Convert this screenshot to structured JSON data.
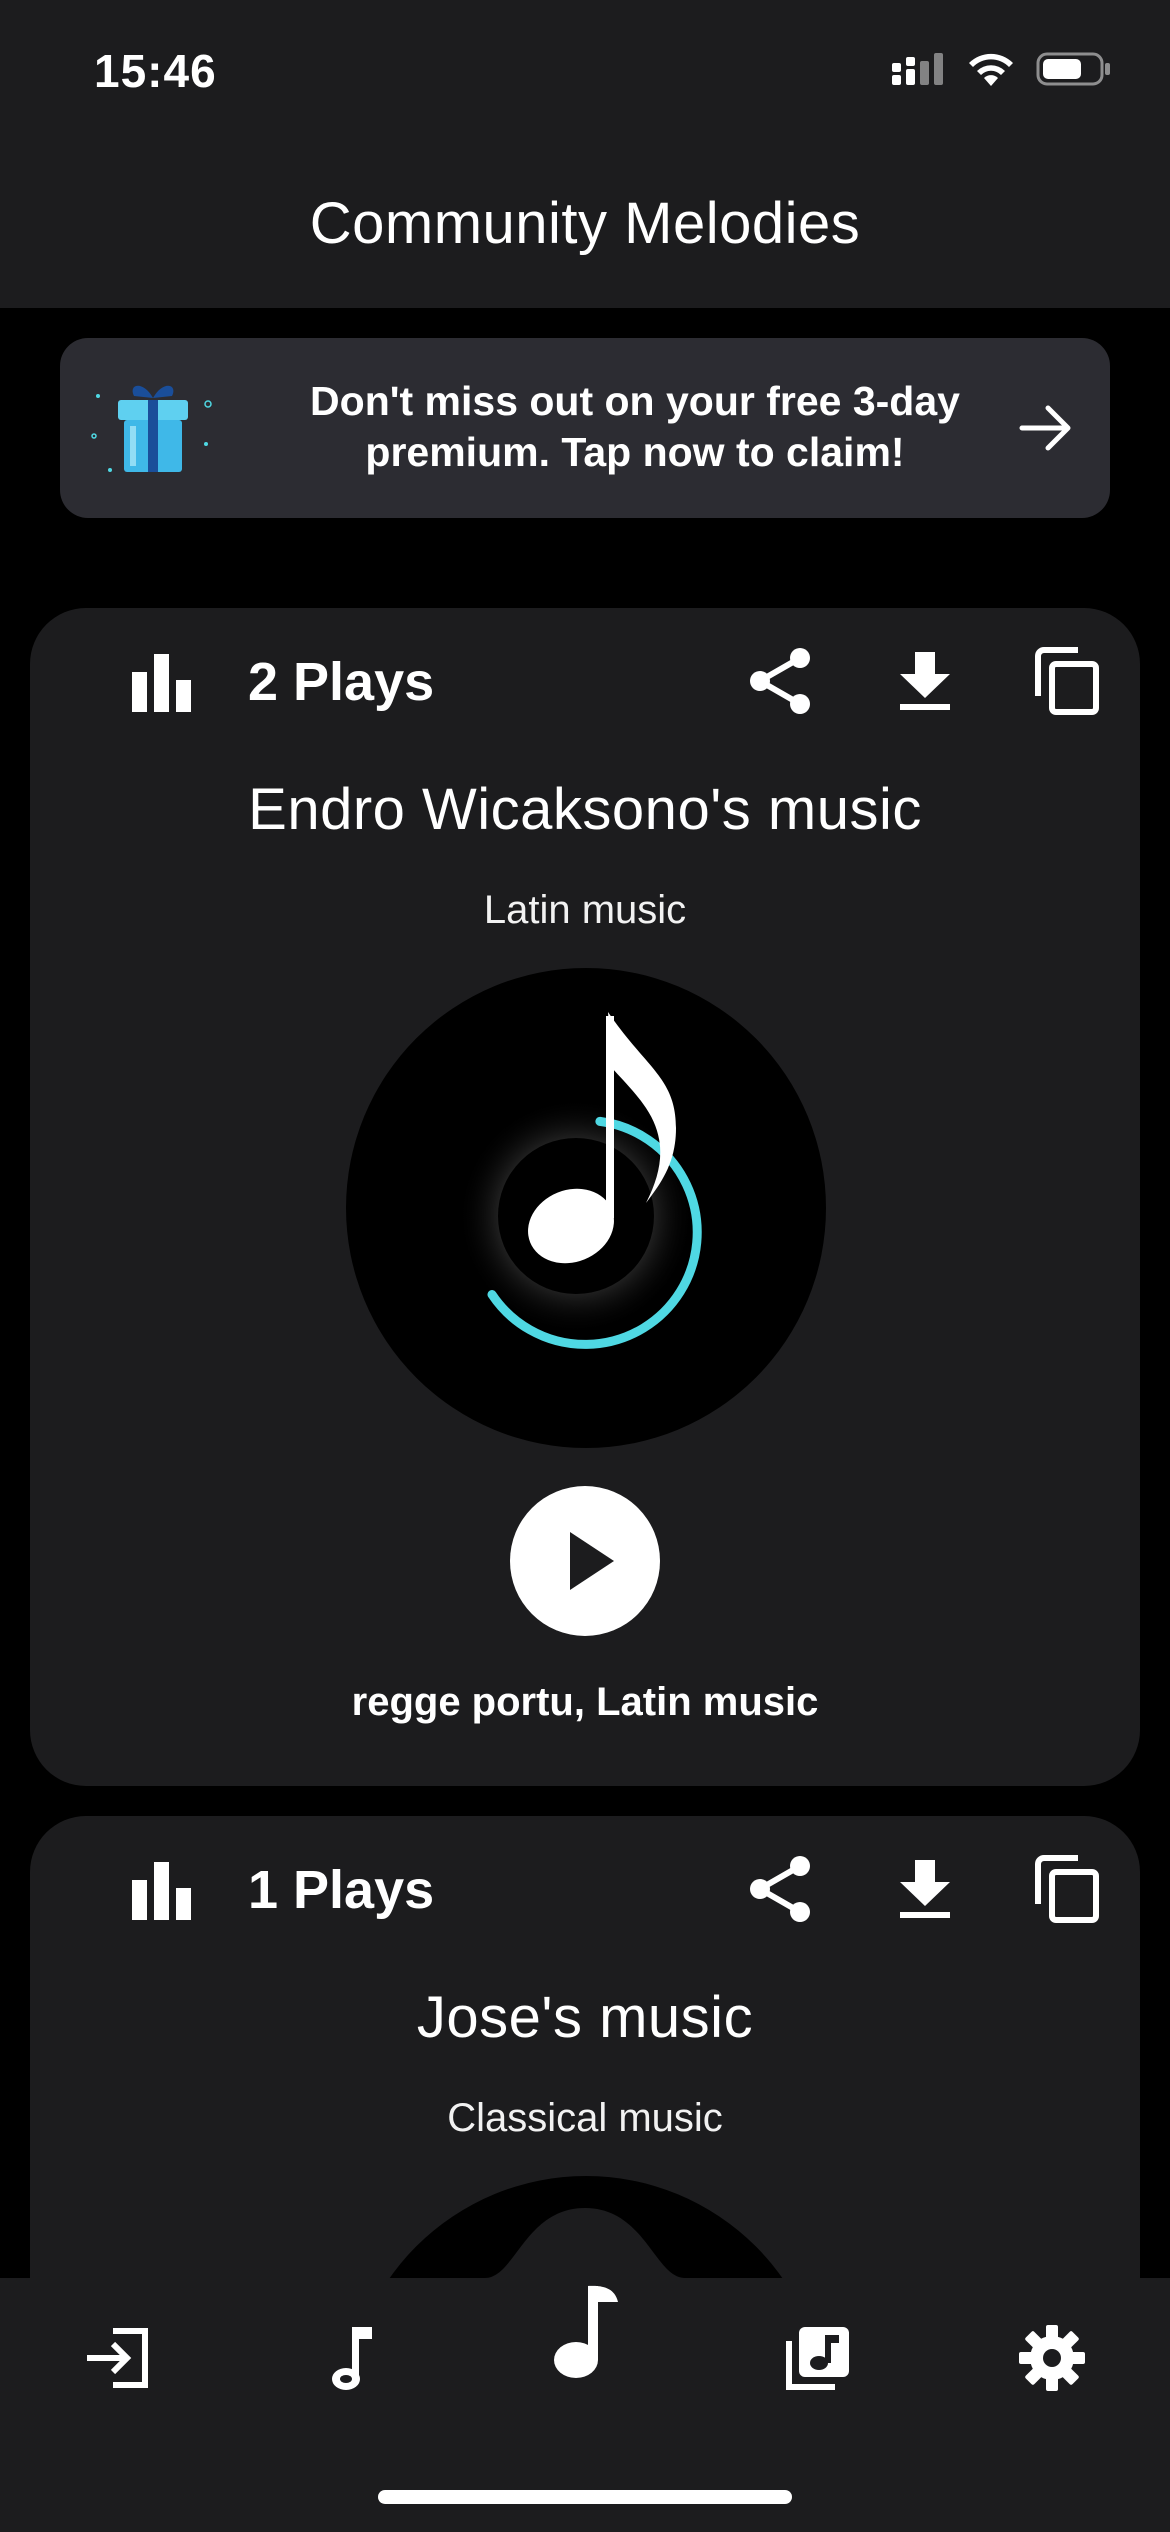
{
  "status_bar": {
    "time": "15:46"
  },
  "header": {
    "title": "Community Melodies"
  },
  "promo": {
    "text": "Don't miss out on your free 3-day premium. Tap now to claim!"
  },
  "cards": [
    {
      "plays": "2 Plays",
      "title": "Endro Wicaksono's music",
      "genre": "Latin music",
      "tags": "regge portu, Latin music"
    },
    {
      "plays": "1 Plays",
      "title": "Jose's music",
      "genre": "Classical music"
    }
  ],
  "tabs": [
    {
      "icon": "sign-in-icon"
    },
    {
      "icon": "music-note-icon"
    },
    {
      "icon": "create-music-icon"
    },
    {
      "icon": "library-icon"
    },
    {
      "icon": "settings-icon"
    }
  ],
  "colors": {
    "accent": "#4fd8e3",
    "card_bg": "#1c1c1e",
    "promo_bg": "#2c2c32",
    "background": "#000000"
  }
}
